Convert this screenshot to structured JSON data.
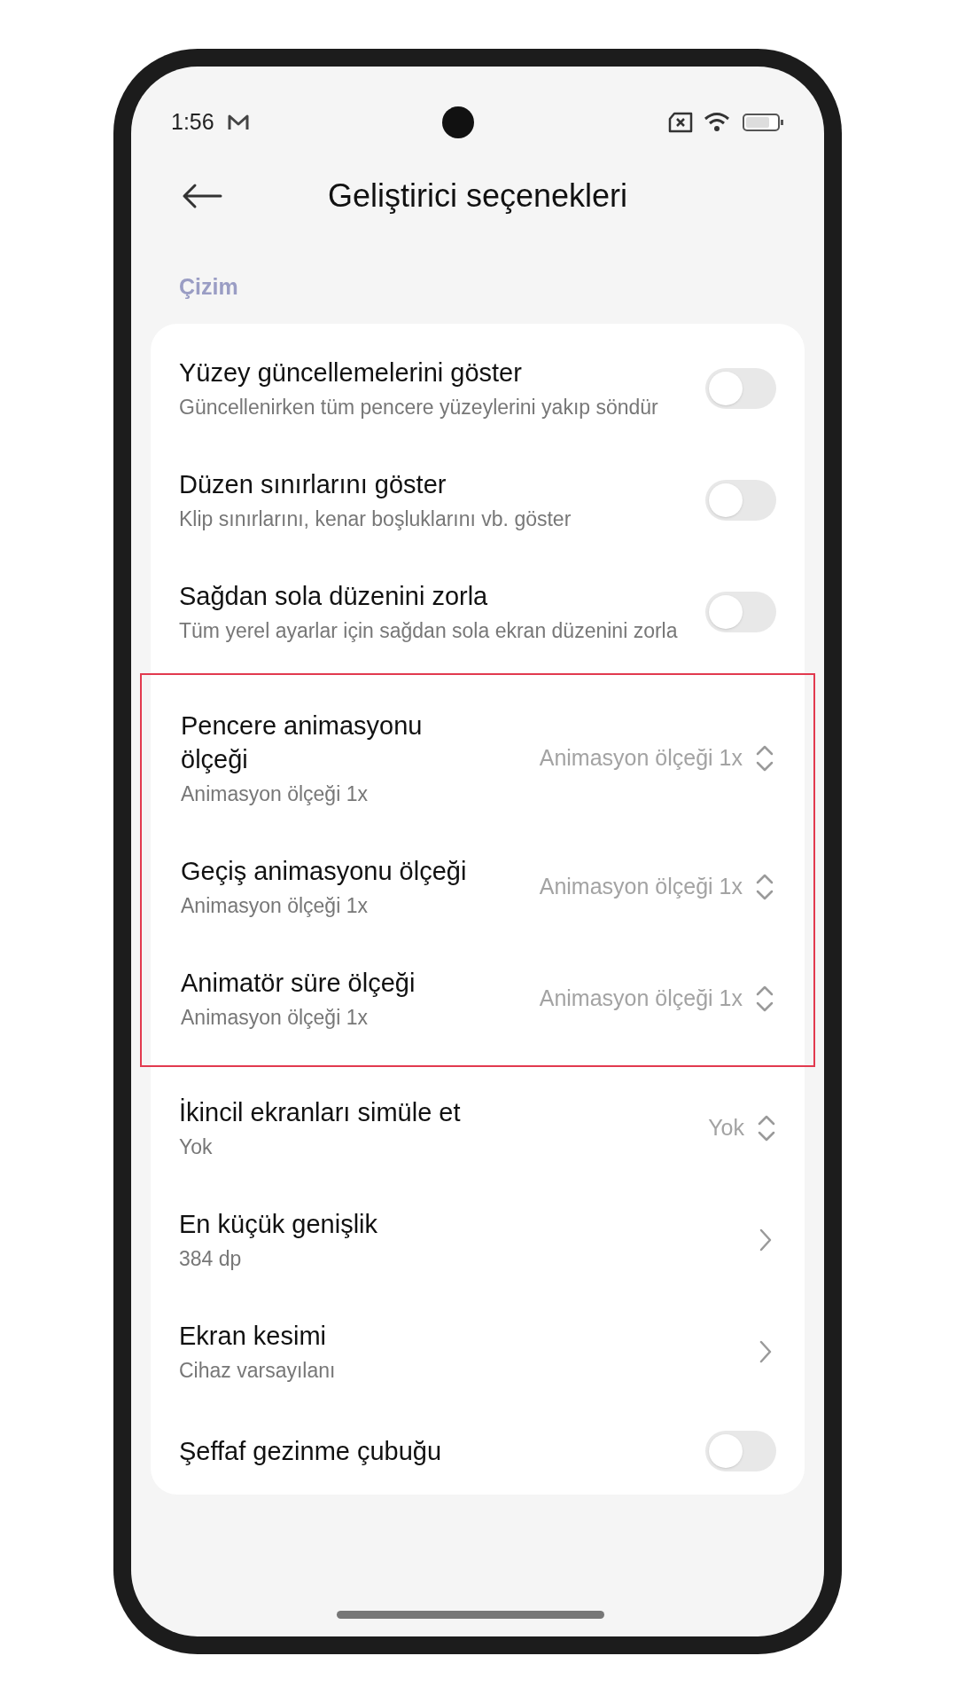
{
  "status_bar": {
    "time": "1:56"
  },
  "header": {
    "title": "Geliştirici seçenekleri"
  },
  "section": {
    "title": "Çizim"
  },
  "rows_before": [
    {
      "kind": "toggle",
      "title": "Yüzey güncellemelerini göster",
      "subtitle": "Güncellenirken tüm pencere yüzeylerini yakıp söndür",
      "on": false
    },
    {
      "kind": "toggle",
      "title": "Düzen sınırlarını göster",
      "subtitle": "Klip sınırlarını, kenar boşluklarını vb. göster",
      "on": false
    },
    {
      "kind": "toggle",
      "title": "Sağdan sola düzenini zorla",
      "subtitle": "Tüm yerel ayarlar için sağdan sola ekran düzenini zorla",
      "on": false
    }
  ],
  "highlighted_rows": [
    {
      "kind": "select",
      "title": "Pencere animasyonu ölçeği",
      "subtitle": "Animasyon ölçeği 1x",
      "value": "Animasyon ölçeği 1x"
    },
    {
      "kind": "select",
      "title": "Geçiş animasyonu ölçeği",
      "subtitle": "Animasyon ölçeği 1x",
      "value": "Animasyon ölçeği 1x"
    },
    {
      "kind": "select",
      "title": "Animatör süre ölçeği",
      "subtitle": "Animasyon ölçeği 1x",
      "value": "Animasyon ölçeği 1x"
    }
  ],
  "rows_after": [
    {
      "kind": "select",
      "title": "İkincil ekranları simüle et",
      "subtitle": "Yok",
      "value": "Yok"
    },
    {
      "kind": "link",
      "title": "En küçük genişlik",
      "subtitle": "384 dp"
    },
    {
      "kind": "link",
      "title": "Ekran kesimi",
      "subtitle": "Cihaz varsayılanı"
    },
    {
      "kind": "toggle",
      "title": "Şeffaf gezinme çubuğu",
      "on": false
    }
  ]
}
